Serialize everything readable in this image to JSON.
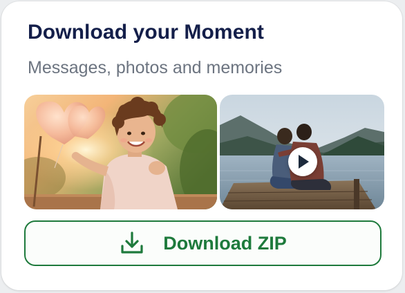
{
  "card": {
    "title": "Download your Moment",
    "subtitle": "Messages, photos and memories"
  },
  "media": {
    "items": [
      {
        "kind": "photo",
        "description_icon": "photo-thumbnail"
      },
      {
        "kind": "video",
        "description_icon": "video-thumbnail",
        "overlay_icon": "play-icon"
      }
    ]
  },
  "download": {
    "label": "Download ZIP",
    "icon": "download-icon"
  },
  "colors": {
    "title": "#141f4a",
    "subtitle": "#6c7480",
    "accent_green": "#1e7a3c",
    "card_background": "#ffffff",
    "page_background": "#eceef0"
  }
}
